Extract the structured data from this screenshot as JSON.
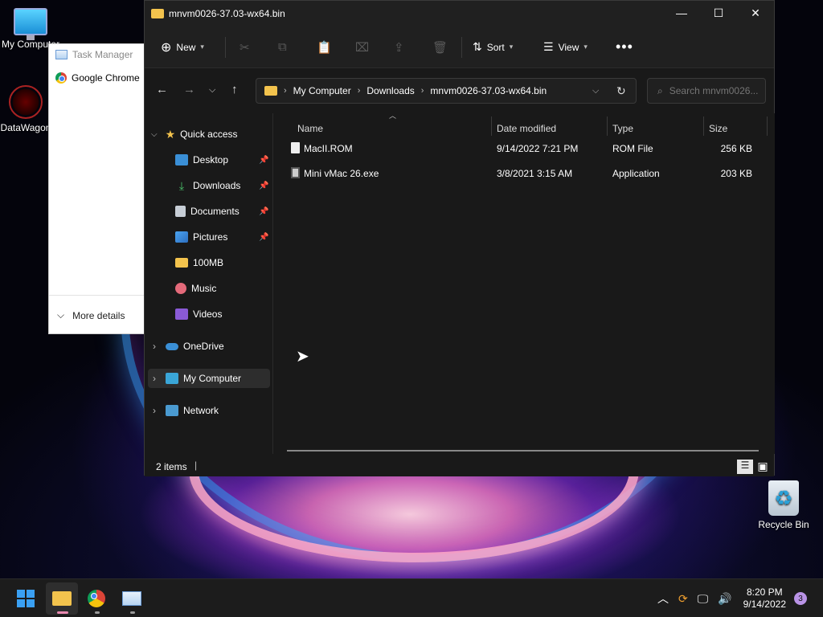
{
  "desktop": {
    "icons": [
      {
        "label": "My Computer"
      },
      {
        "label": "DataWagon"
      },
      {
        "label": "Recycle Bin"
      }
    ]
  },
  "task_manager": {
    "title": "Task Manager",
    "app_item": "Google Chrome",
    "more_details": "More details"
  },
  "explorer": {
    "title": "mnvm0026-37.03-wx64.bin",
    "commands": {
      "new": "New",
      "sort": "Sort",
      "view": "View"
    },
    "breadcrumb": [
      "My Computer",
      "Downloads",
      "mnvm0026-37.03-wx64.bin"
    ],
    "search_placeholder": "Search mnvm0026...",
    "nav": {
      "quick_access": "Quick access",
      "items": [
        {
          "label": "Desktop",
          "pinned": true,
          "icon": "desktop-icon"
        },
        {
          "label": "Downloads",
          "pinned": true,
          "icon": "downloads-icon"
        },
        {
          "label": "Documents",
          "pinned": true,
          "icon": "documents-icon"
        },
        {
          "label": "Pictures",
          "pinned": true,
          "icon": "pictures-icon"
        },
        {
          "label": "100MB",
          "pinned": false,
          "icon": "folder-icon"
        },
        {
          "label": "Music",
          "pinned": false,
          "icon": "music-icon"
        },
        {
          "label": "Videos",
          "pinned": false,
          "icon": "videos-icon"
        }
      ],
      "onedrive": "OneDrive",
      "my_computer": "My Computer",
      "network": "Network"
    },
    "columns": {
      "name": "Name",
      "date_modified": "Date modified",
      "type": "Type",
      "size": "Size"
    },
    "files": [
      {
        "name": "MacII.ROM",
        "date": "9/14/2022 7:21 PM",
        "type": "ROM File",
        "size": "256 KB"
      },
      {
        "name": "Mini vMac 26.exe",
        "date": "3/8/2021 3:15 AM",
        "type": "Application",
        "size": "203 KB"
      }
    ],
    "status": "2 items"
  },
  "taskbar": {
    "time": "8:20 PM",
    "date": "9/14/2022",
    "notifications": "3"
  },
  "colors": {
    "accent": "#3aa0f3",
    "folder": "#f3c34d",
    "window_bg": "#191919"
  }
}
